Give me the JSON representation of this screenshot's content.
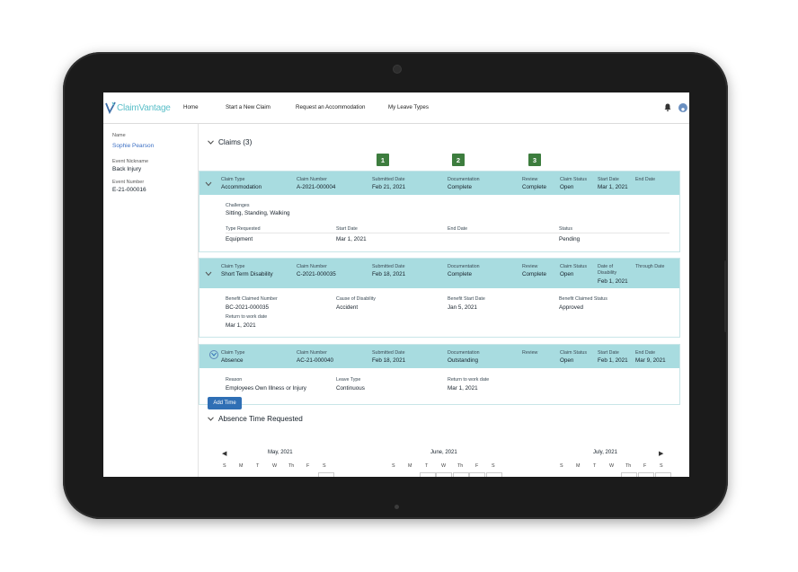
{
  "app": {
    "logo_text": "ClaimVantage",
    "brand_color": "#5bbfc9"
  },
  "nav": {
    "items": [
      {
        "label": "Home"
      },
      {
        "label": "Start a New Claim"
      },
      {
        "label": "Request an Accommodation"
      },
      {
        "label": "My Leave Types"
      }
    ]
  },
  "sidebar": {
    "name_label": "Name",
    "name_value": "Sophie Pearson",
    "nickname_label": "Event Nickname",
    "nickname_value": "Back Injury",
    "event_number_label": "Event Number",
    "event_number_value": "E-21-000016"
  },
  "claims": {
    "title": "Claims (3)",
    "steps": [
      "1",
      "2",
      "3"
    ],
    "step_color": "#3d7d3e",
    "header_color": "#a8dce0",
    "items": [
      {
        "head": [
          {
            "label": "Claim Type",
            "value": "Accommodation"
          },
          {
            "label": "Claim Number",
            "value": "A-2021-000004"
          },
          {
            "label": "Submitted Date",
            "value": "Feb 21, 2021"
          },
          {
            "label": "Documentation",
            "value": "Complete"
          },
          {
            "label": "Review",
            "value": "Complete"
          },
          {
            "label": "Claim Status",
            "value": "Open"
          },
          {
            "label": "Start Date",
            "value": "Mar 1, 2021"
          },
          {
            "label": "End Date",
            "value": ""
          }
        ],
        "challenges_label": "Challenges",
        "challenges_value": "Sitting, Standing, Walking",
        "detail": [
          {
            "label": "Type Requested",
            "value": "Equipment"
          },
          {
            "label": "Start Date",
            "value": "Mar 1, 2021"
          },
          {
            "label": "End Date",
            "value": ""
          },
          {
            "label": "Status",
            "value": "Pending"
          }
        ]
      },
      {
        "head": [
          {
            "label": "Claim Type",
            "value": "Short Term Disability"
          },
          {
            "label": "Claim Number",
            "value": "C-2021-000035"
          },
          {
            "label": "Submitted Date",
            "value": "Feb 18, 2021"
          },
          {
            "label": "Documentation",
            "value": "Complete"
          },
          {
            "label": "Review",
            "value": "Complete"
          },
          {
            "label": "Claim Status",
            "value": "Open"
          },
          {
            "label": "Date of Disability",
            "value": "Feb 1, 2021"
          },
          {
            "label": "Through Date",
            "value": ""
          }
        ],
        "detail": [
          {
            "label": "Benefit Claimed Number",
            "value": "BC-2021-000035"
          },
          {
            "label": "Cause of Disability",
            "value": "Accident"
          },
          {
            "label": "Benefit Start Date",
            "value": "Jan 5, 2021"
          },
          {
            "label": "Benefit Claimed Status",
            "value": "Approved"
          }
        ],
        "return_label": "Return to work date",
        "return_value": "Mar 1, 2021"
      },
      {
        "head": [
          {
            "label": "Claim Type",
            "value": "Absence"
          },
          {
            "label": "Claim Number",
            "value": "AC-21-000040"
          },
          {
            "label": "Submitted Date",
            "value": "Feb 18, 2021"
          },
          {
            "label": "Documentation",
            "value": "Outstanding"
          },
          {
            "label": "Review",
            "value": ""
          },
          {
            "label": "Claim Status",
            "value": "Open"
          },
          {
            "label": "Start Date",
            "value": "Feb 1, 2021"
          },
          {
            "label": "End Date",
            "value": "Mar 9, 2021"
          }
        ],
        "detail": [
          {
            "label": "Reason",
            "value": "Employees Own Illness or Injury"
          },
          {
            "label": "Leave Type",
            "value": "Continuous"
          },
          {
            "label": "Return to work date",
            "value": "Mar 1, 2021"
          }
        ]
      }
    ]
  },
  "absence": {
    "title": "Absence Time Requested",
    "add_button": "Add Time",
    "add_button_color": "#2f6fb5",
    "months": [
      "May, 2021",
      "June, 2021",
      "July, 2021"
    ],
    "weekdays": [
      "S",
      "M",
      "T",
      "W",
      "Th",
      "F",
      "S"
    ],
    "prev_icon": "◀",
    "next_icon": "▶"
  }
}
